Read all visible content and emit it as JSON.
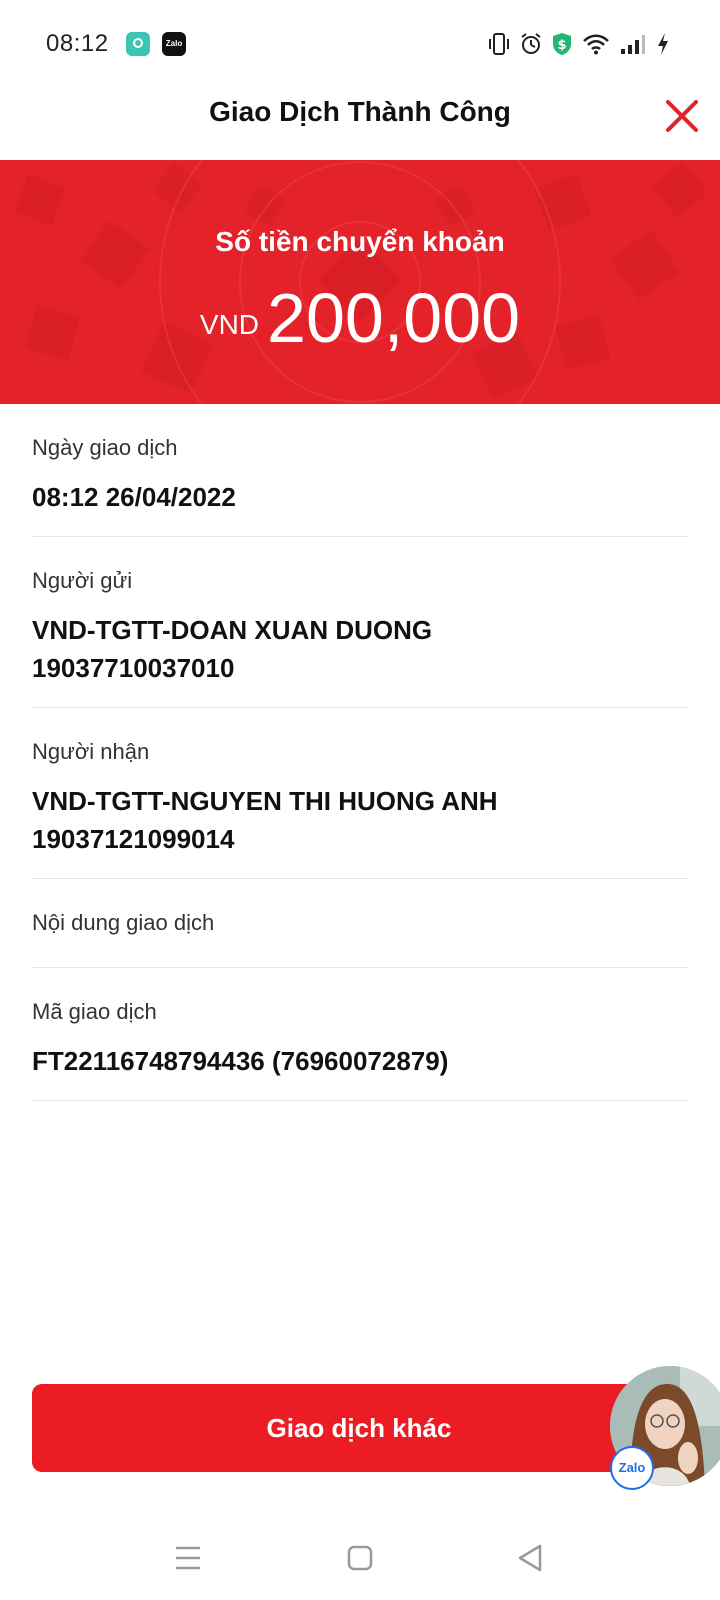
{
  "status_bar": {
    "time": "08:12",
    "apps": [
      {
        "name": "assistant-app-icon",
        "color": "#3cc5b4"
      },
      {
        "name": "zalo-app-icon",
        "label": "Zalo"
      }
    ],
    "icons": [
      "vibrate-icon",
      "alarm-icon",
      "shield-dollar-icon",
      "wifi-icon",
      "signal-icon",
      "charging-icon"
    ]
  },
  "header": {
    "title": "Giao Dịch Thành Công",
    "close_icon": "close-icon",
    "close_color": "#e3222a"
  },
  "banner": {
    "label": "Số tiền chuyển khoản",
    "currency": "VND",
    "amount": "200,000",
    "background": "#e3222a"
  },
  "details": [
    {
      "label": "Ngày giao dịch",
      "value": "08:12 26/04/2022",
      "value2": ""
    },
    {
      "label": "Người gửi",
      "value": "VND-TGTT-DOAN XUAN DUONG",
      "value2": "19037710037010"
    },
    {
      "label": "Người nhận",
      "value": "VND-TGTT-NGUYEN THI HUONG ANH",
      "value2": "19037121099014"
    },
    {
      "label": "Nội dung giao dịch",
      "value": "",
      "value2": ""
    },
    {
      "label": "Mã giao dịch",
      "value": "FT22116748794436 (76960072879)",
      "value2": ""
    }
  ],
  "cta": {
    "label": "Giao dịch khác",
    "color": "#ec1c24"
  },
  "chat_bubble": {
    "badge": "Zalo"
  },
  "nav": {
    "icons": [
      "menu-icon",
      "home-icon",
      "back-icon"
    ]
  }
}
